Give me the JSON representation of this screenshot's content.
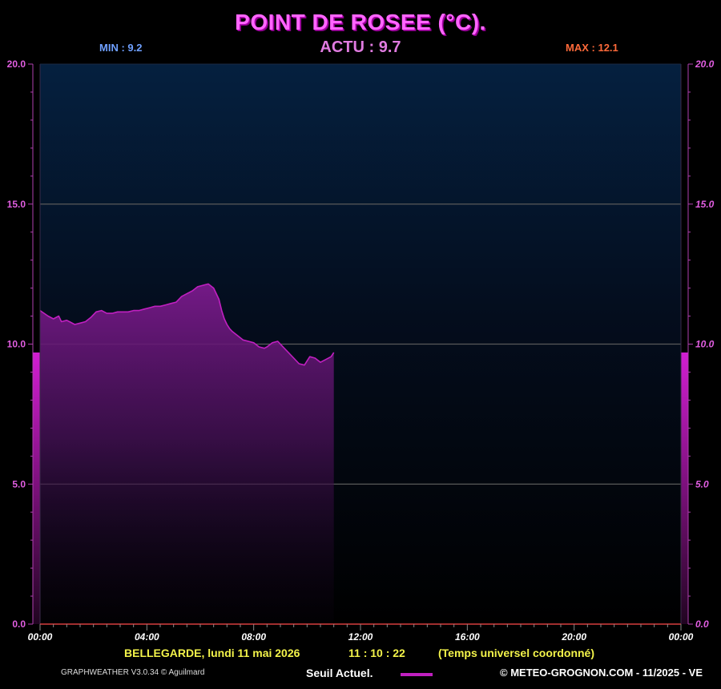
{
  "header": {
    "title": "POINT DE ROSEE  (°C).",
    "min_label": "MIN :",
    "min_value": "9.2",
    "actu_label": "ACTU :",
    "actu_value": "9.7",
    "max_label": "MAX :",
    "max_value": "12.1"
  },
  "footer": {
    "location_date": "BELLEGARDE, lundi 11 mai 2026",
    "time": "11 : 10 : 22",
    "timezone": "(Temps universel coordonné)",
    "credit": "GRAPHWEATHER V3.0.34 © Aguilmard",
    "legend_label": "Seuil Actuel.",
    "copyright": "© METEO-GROGNON.COM - 11/2025 - VE"
  },
  "colors": {
    "series": "#c020c0",
    "accent": "#ff66ff",
    "min": "#6fa0ff",
    "max": "#ff6a3a",
    "footer": "#f3f34a"
  },
  "chart_data": {
    "type": "area",
    "title": "POINT DE ROSEE  (°C).",
    "xlabel": "",
    "ylabel": "",
    "x_unit": "hours",
    "xlim": [
      0,
      24
    ],
    "ylim": [
      0,
      20
    ],
    "grid": true,
    "x_ticks": [
      0,
      4,
      8,
      12,
      16,
      20,
      24
    ],
    "x_tick_labels": [
      "00:00",
      "04:00",
      "08:00",
      "12:00",
      "16:00",
      "20:00",
      "00:00"
    ],
    "y_ticks": [
      0,
      5,
      10,
      15,
      20
    ],
    "y_tick_labels": [
      "0.0",
      "5.0",
      "10.0",
      "15.0",
      "20.0"
    ],
    "current_value": 9.7,
    "series": [
      {
        "name": "",
        "x": [
          0.0,
          0.3,
          0.5,
          0.7,
          0.8,
          1.0,
          1.1,
          1.3,
          1.5,
          1.7,
          1.9,
          2.1,
          2.3,
          2.5,
          2.7,
          2.9,
          3.1,
          3.3,
          3.5,
          3.7,
          3.9,
          4.1,
          4.3,
          4.5,
          4.7,
          4.9,
          5.1,
          5.3,
          5.5,
          5.7,
          5.9,
          6.1,
          6.3,
          6.5,
          6.7,
          6.8,
          6.9,
          7.0,
          7.1,
          7.2,
          7.4,
          7.6,
          7.8,
          8.0,
          8.2,
          8.4,
          8.5,
          8.7,
          8.9,
          9.1,
          9.3,
          9.5,
          9.7,
          9.9,
          10.1,
          10.3,
          10.5,
          10.7,
          10.9,
          11.0
        ],
        "values": [
          11.2,
          11.0,
          10.9,
          11.0,
          10.8,
          10.85,
          10.8,
          10.7,
          10.75,
          10.8,
          10.95,
          11.15,
          11.2,
          11.1,
          11.1,
          11.15,
          11.15,
          11.15,
          11.2,
          11.2,
          11.25,
          11.3,
          11.35,
          11.35,
          11.4,
          11.45,
          11.5,
          11.7,
          11.8,
          11.9,
          12.05,
          12.1,
          12.15,
          12.0,
          11.6,
          11.2,
          10.9,
          10.7,
          10.55,
          10.45,
          10.3,
          10.15,
          10.1,
          10.05,
          9.9,
          9.85,
          9.9,
          10.05,
          10.1,
          9.9,
          9.7,
          9.5,
          9.3,
          9.25,
          9.55,
          9.5,
          9.35,
          9.45,
          9.55,
          9.7
        ]
      }
    ]
  }
}
